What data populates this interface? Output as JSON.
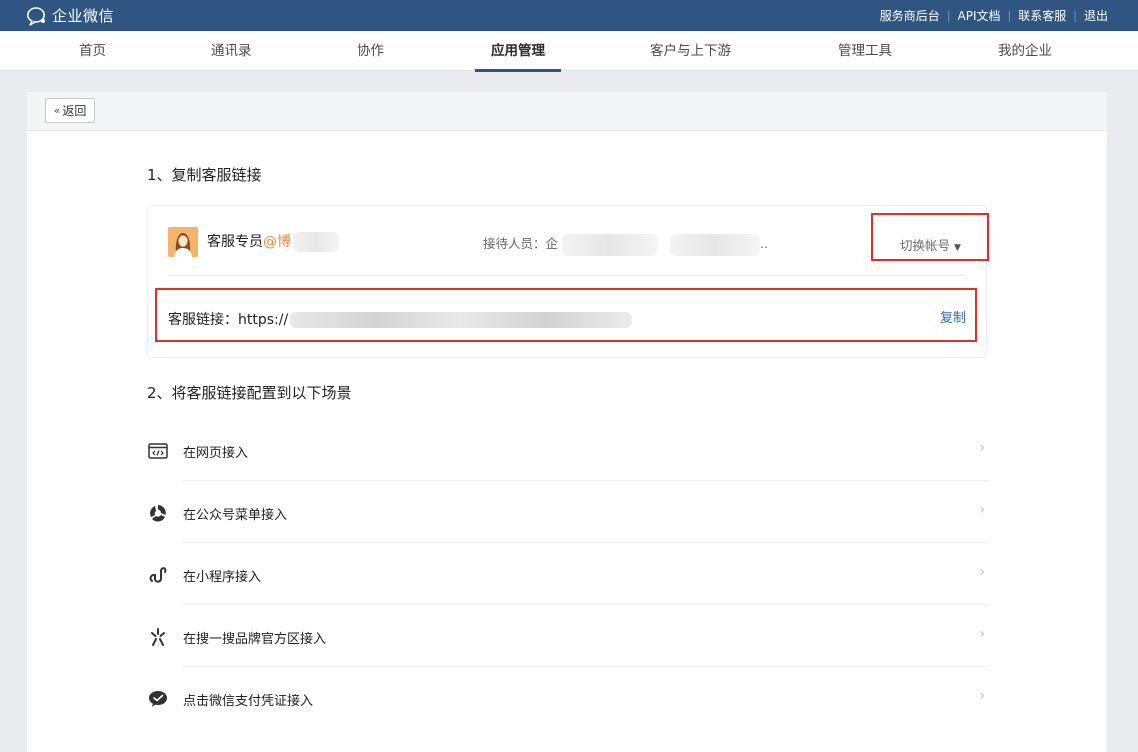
{
  "topbar": {
    "brand": "企业微信",
    "links": [
      "服务商后台",
      "API文档",
      "联系客服",
      "退出"
    ]
  },
  "nav": {
    "items": [
      "首页",
      "通讯录",
      "协作",
      "应用管理",
      "客户与上下游",
      "管理工具",
      "我的企业"
    ],
    "active": "应用管理"
  },
  "panel": {
    "back_label": "返回",
    "step1_title": "1、复制客服链接",
    "account": {
      "name": "客服专员",
      "handle": "@博",
      "receiver_label": "接待人员：",
      "receiver_value": "企",
      "receiver_suffix": "..",
      "switch_label": "切换帐号"
    },
    "link": {
      "label": "客服链接：",
      "url_prefix": "https://",
      "copy_label": "复制"
    },
    "step2_title": "2、将客服链接配置到以下场景",
    "scenes": [
      {
        "label": "在网页接入",
        "icon": "code-window-icon"
      },
      {
        "label": "在公众号菜单接入",
        "icon": "official-account-icon"
      },
      {
        "label": "在小程序接入",
        "icon": "mini-program-icon"
      },
      {
        "label": "在搜一搜品牌官方区接入",
        "icon": "search-sparkle-icon"
      },
      {
        "label": "点击微信支付凭证接入",
        "icon": "wechat-pay-icon"
      }
    ]
  },
  "colors": {
    "topbar_bg": "#2f5583",
    "highlight_box": "#d9312b",
    "link_blue": "#2d6ab8",
    "handle_orange": "#f08c3c"
  }
}
